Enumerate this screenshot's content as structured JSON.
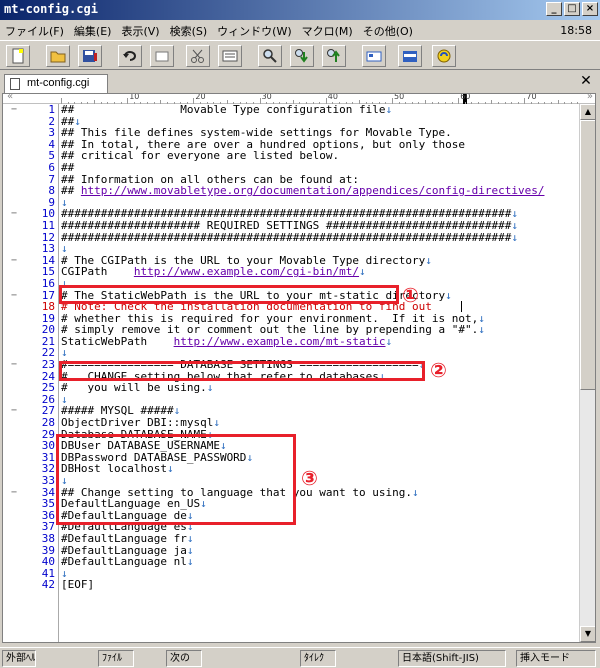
{
  "window": {
    "title": "mt-config.cgi",
    "buttons": [
      "_",
      "□",
      "×"
    ]
  },
  "menu": {
    "items": [
      "ファイル(F)",
      "編集(E)",
      "表示(V)",
      "検索(S)",
      "ウィンドウ(W)",
      "マクロ(M)",
      "その他(O)"
    ],
    "clock": "18:58"
  },
  "tabs": [
    {
      "label": "mt-config.cgi"
    }
  ],
  "ruler": {
    "marks": [
      "10",
      "20",
      "30",
      "40",
      "50",
      "60",
      "70"
    ]
  },
  "editor": {
    "lines": [
      {
        "n": "1",
        "text": "##                Movable Type configuration file",
        "eol": "↓",
        "fold": "−"
      },
      {
        "n": "2",
        "text": "##",
        "eol": "↓"
      },
      {
        "n": "3",
        "text": "## This file defines system-wide settings for Movable Type.",
        "eol": ""
      },
      {
        "n": "4",
        "text": "## In total, there are over a hundred options, but only those",
        "eol": ""
      },
      {
        "n": "5",
        "text": "## critical for everyone are listed below.",
        "eol": ""
      },
      {
        "n": "6",
        "text": "##",
        "eol": ""
      },
      {
        "n": "7",
        "text": "## Information on all others can be found at:",
        "eol": ""
      },
      {
        "n": "8",
        "text": "## ",
        "url": "http://www.movabletype.org/documentation/appendices/config-directives/",
        "eol": ""
      },
      {
        "n": "9",
        "text": "",
        "eol": "↓"
      },
      {
        "n": "10",
        "text": "####################################################################",
        "eol": "↓",
        "fold": "−"
      },
      {
        "n": "11",
        "text": "##################### REQUIRED SETTINGS ############################",
        "eol": "↓"
      },
      {
        "n": "12",
        "text": "####################################################################",
        "eol": "↓"
      },
      {
        "n": "13",
        "text": "",
        "eol": "↓"
      },
      {
        "n": "14",
        "text": "# The CGIPath is the URL to your Movable Type directory",
        "eol": "↓",
        "fold": "−"
      },
      {
        "n": "15",
        "text": "CGIPath    ",
        "url": "http://www.example.com/cgi-bin/mt/",
        "eol": "↓"
      },
      {
        "n": "16",
        "text": "",
        "eol": "↓"
      },
      {
        "n": "17",
        "text": "# The StaticWebPath is the URL to your mt-static directory",
        "eol": "↓",
        "fold": "−"
      },
      {
        "n": "18",
        "text": "# Note: Check the installation documentation to find out ",
        "eol": "",
        "red": true
      },
      {
        "n": "19",
        "text": "# whether this is required for your environment.  If it is not,",
        "eol": "↓"
      },
      {
        "n": "20",
        "text": "# simply remove it or comment out the line by prepending a \"#\".",
        "eol": "↓"
      },
      {
        "n": "21",
        "text": "StaticWebPath    ",
        "url": "http://www.example.com/mt-static",
        "eol": "↓"
      },
      {
        "n": "22",
        "text": "",
        "eol": "↓"
      },
      {
        "n": "23",
        "text": "#================ DATABASE SETTINGS ==================",
        "eol": "↓",
        "fold": "−"
      },
      {
        "n": "24",
        "text": "#   CHANGE setting below that refer to databases",
        "eol": "↓"
      },
      {
        "n": "25",
        "text": "#   you will be using.",
        "eol": "↓"
      },
      {
        "n": "26",
        "text": "",
        "eol": "↓"
      },
      {
        "n": "27",
        "text": "##### MYSQL #####",
        "eol": "↓",
        "fold": "−"
      },
      {
        "n": "28",
        "text": "ObjectDriver DBI::mysql",
        "eol": "↓"
      },
      {
        "n": "29",
        "text": "Database DATABASE_NAME",
        "eol": "↓"
      },
      {
        "n": "30",
        "text": "DBUser DATABASE_USERNAME",
        "eol": "↓"
      },
      {
        "n": "31",
        "text": "DBPassword DATABASE_PASSWORD",
        "eol": "↓"
      },
      {
        "n": "32",
        "text": "DBHost localhost",
        "eol": "↓"
      },
      {
        "n": "33",
        "text": "",
        "eol": "↓"
      },
      {
        "n": "34",
        "text": "## Change setting to language that you want to using.",
        "eol": "↓",
        "fold": "−"
      },
      {
        "n": "35",
        "text": "DefaultLanguage en_US",
        "eol": "↓"
      },
      {
        "n": "36",
        "text": "#DefaultLanguage de",
        "eol": "↓"
      },
      {
        "n": "37",
        "text": "#DefaultLanguage es",
        "eol": "↓"
      },
      {
        "n": "38",
        "text": "#DefaultLanguage fr",
        "eol": "↓"
      },
      {
        "n": "39",
        "text": "#DefaultLanguage ja",
        "eol": "↓"
      },
      {
        "n": "40",
        "text": "#DefaultLanguage nl",
        "eol": "↓"
      },
      {
        "n": "41",
        "text": "",
        "eol": "↓"
      },
      {
        "n": "42",
        "text": "[EOF]",
        "eol": ""
      }
    ]
  },
  "callouts": [
    "①",
    "②",
    "③"
  ],
  "status": {
    "items": [
      "外部ﾍﾙ",
      "ﾌｧｲﾙ",
      "次の",
      "ﾀｲﾚｸ",
      "日本語(Shift-JIS)",
      "挿入モード"
    ]
  },
  "colors": {
    "highlight": "#e8202a",
    "line_numbers": "#0000cc",
    "url": "#6600aa"
  }
}
